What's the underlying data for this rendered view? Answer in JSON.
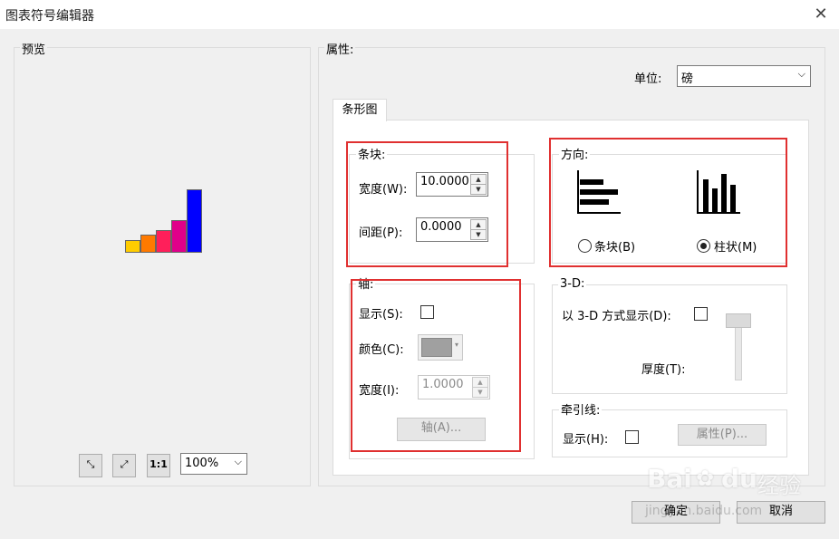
{
  "window": {
    "title": "图表符号编辑器",
    "close_glyph": "✕"
  },
  "preview": {
    "label": "预览",
    "zoom": "100%",
    "bar_colors": [
      "#ffcc00",
      "#ff7a00",
      "#ff1f5a",
      "#e0008a",
      "#0000ff"
    ],
    "bar_values": [
      1,
      1.5,
      2.2,
      3.3,
      6.8
    ],
    "tools": {
      "fit_glyph": "⤡",
      "full_glyph": "⤢",
      "actual_glyph": "1:1"
    }
  },
  "properties": {
    "label": "属性:",
    "unit_label": "单位:",
    "unit_value": "磅",
    "tab": "条形图",
    "bars": {
      "label": "条块:",
      "width_label": "宽度(W):",
      "width_value": "10.0000",
      "spacing_label": "间距(P):",
      "spacing_value": "0.0000"
    },
    "orientation": {
      "label": "方向:",
      "option_bar": "条块(B)",
      "option_column": "柱状(M)",
      "selected": "column"
    },
    "axis": {
      "label": "轴:",
      "show_label": "显示(S):",
      "color_label": "颜色(C):",
      "color_value": "#a0a0a0",
      "width_label": "宽度(I):",
      "width_value": "1.0000",
      "axis_button": "轴(A)..."
    },
    "three_d": {
      "label": "3-D:",
      "show_label": "以 3-D 方式显示(D):",
      "thickness_label": "厚度(T):"
    },
    "leader": {
      "label": "牵引线:",
      "show_label": "显示(H):",
      "props_button": "属性(P)..."
    }
  },
  "footer": {
    "ok": "确定",
    "cancel": "取消"
  },
  "watermark": {
    "brand": "Bai",
    "brand2": "du",
    "suffix": "经验",
    "url": "jingyan.baidu.com"
  }
}
